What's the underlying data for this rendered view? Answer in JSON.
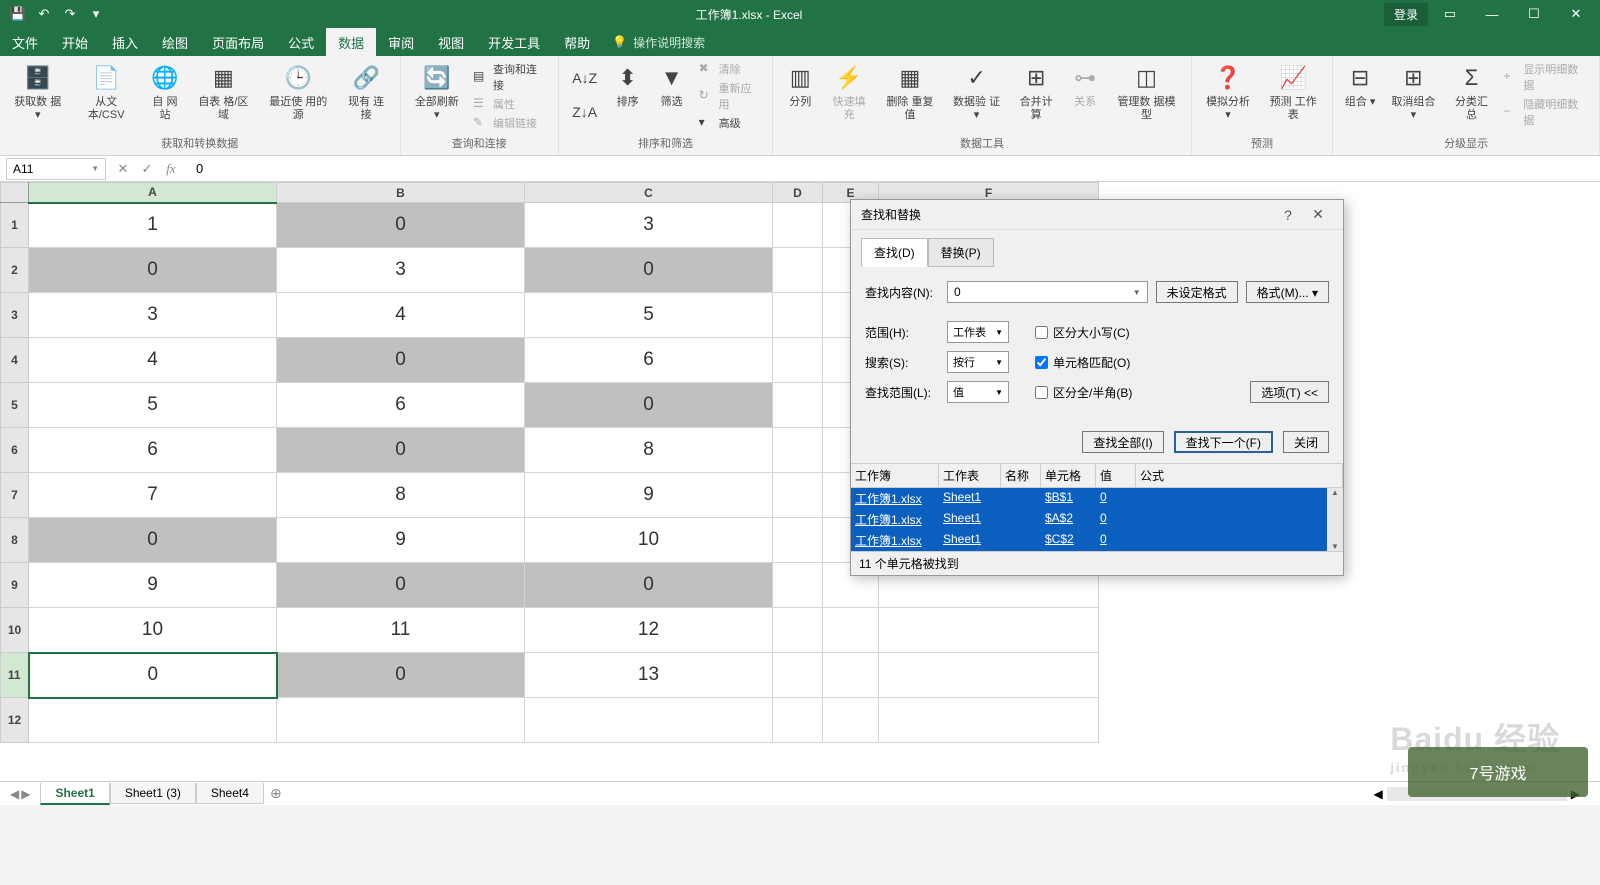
{
  "title": "工作簿1.xlsx - Excel",
  "qat": {
    "save": "💾",
    "undo": "↶",
    "redo": "↷",
    "custom": "▾"
  },
  "login": "登录",
  "menu": [
    "文件",
    "开始",
    "插入",
    "绘图",
    "页面布局",
    "公式",
    "数据",
    "审阅",
    "视图",
    "开发工具",
    "帮助"
  ],
  "menu_active": 6,
  "tell_me": "操作说明搜索",
  "ribbon": {
    "g1": {
      "label": "获取和转换数据",
      "btns": [
        "获取数\n据 ▾",
        "从文\n本/CSV",
        "自\n网站",
        "自表\n格/区域",
        "最近使\n用的源",
        "现有\n连接"
      ]
    },
    "g2": {
      "label": "查询和连接",
      "main": "全部刷新\n▾",
      "side": [
        "查询和连接",
        "属性",
        "编辑链接"
      ]
    },
    "g3": {
      "label": "排序和筛选",
      "btns": [
        "排序",
        "筛选"
      ],
      "side": [
        "清除",
        "重新应用",
        "高级"
      ]
    },
    "g4": {
      "label": "数据工具",
      "btns": [
        "分列",
        "快速填充",
        "删除\n重复值",
        "数据验\n证 ▾",
        "合并计算",
        "关系",
        "管理数\n据模型"
      ]
    },
    "g5": {
      "label": "预测",
      "btns": [
        "模拟分析\n▾",
        "预测\n工作表"
      ]
    },
    "g6": {
      "label": "分级显示",
      "btns": [
        "组合\n▾",
        "取消组合\n▾",
        "分类汇总"
      ],
      "side": [
        "显示明细数据",
        "隐藏明细数据"
      ]
    }
  },
  "namebox": "A11",
  "formula": "0",
  "columns": [
    "A",
    "B",
    "C",
    "D",
    "E",
    "F"
  ],
  "data_cells": [
    [
      {
        "v": "1",
        "s": 0
      },
      {
        "v": "0",
        "s": 1
      },
      {
        "v": "3",
        "s": 0
      }
    ],
    [
      {
        "v": "0",
        "s": 1
      },
      {
        "v": "3",
        "s": 0
      },
      {
        "v": "0",
        "s": 1
      }
    ],
    [
      {
        "v": "3",
        "s": 0
      },
      {
        "v": "4",
        "s": 0
      },
      {
        "v": "5",
        "s": 0
      }
    ],
    [
      {
        "v": "4",
        "s": 0
      },
      {
        "v": "0",
        "s": 1
      },
      {
        "v": "6",
        "s": 0
      }
    ],
    [
      {
        "v": "5",
        "s": 0
      },
      {
        "v": "6",
        "s": 0
      },
      {
        "v": "0",
        "s": 1
      }
    ],
    [
      {
        "v": "6",
        "s": 0
      },
      {
        "v": "0",
        "s": 1
      },
      {
        "v": "8",
        "s": 0
      }
    ],
    [
      {
        "v": "7",
        "s": 0
      },
      {
        "v": "8",
        "s": 0
      },
      {
        "v": "9",
        "s": 0
      }
    ],
    [
      {
        "v": "0",
        "s": 1
      },
      {
        "v": "9",
        "s": 0
      },
      {
        "v": "10",
        "s": 0
      }
    ],
    [
      {
        "v": "9",
        "s": 0
      },
      {
        "v": "0",
        "s": 1
      },
      {
        "v": "0",
        "s": 1
      }
    ],
    [
      {
        "v": "10",
        "s": 0
      },
      {
        "v": "11",
        "s": 0
      },
      {
        "v": "12",
        "s": 0
      }
    ],
    [
      {
        "v": "0",
        "s": 0
      },
      {
        "v": "0",
        "s": 1
      },
      {
        "v": "13",
        "s": 0
      }
    ]
  ],
  "active_cell": {
    "row": 11,
    "col": 0
  },
  "dialog": {
    "title": "查找和替换",
    "tabs": [
      "查找(D)",
      "替换(P)"
    ],
    "find_label": "查找内容(N):",
    "find_value": "0",
    "no_format": "未设定格式",
    "format_btn": "格式(M)... ▾",
    "range_label": "范围(H):",
    "range_val": "工作表",
    "search_label": "搜索(S):",
    "search_val": "按行",
    "lookin_label": "查找范围(L):",
    "lookin_val": "值",
    "chk_case": "区分大小写(C)",
    "chk_whole": "单元格匹配(O)",
    "chk_width": "区分全/半角(B)",
    "options_btn": "选项(T) <<",
    "find_all": "查找全部(I)",
    "find_next": "查找下一个(F)",
    "close": "关闭",
    "cols": [
      "工作簿",
      "工作表",
      "名称",
      "单元格",
      "值",
      "公式"
    ],
    "results": [
      {
        "wb": "工作簿1.xlsx",
        "ws": "Sheet1",
        "nm": "",
        "cell": "$B$1",
        "val": "0",
        "fm": ""
      },
      {
        "wb": "工作簿1.xlsx",
        "ws": "Sheet1",
        "nm": "",
        "cell": "$A$2",
        "val": "0",
        "fm": ""
      },
      {
        "wb": "工作簿1.xlsx",
        "ws": "Sheet1",
        "nm": "",
        "cell": "$C$2",
        "val": "0",
        "fm": ""
      }
    ],
    "status": "11 个单元格被找到"
  },
  "sheets": [
    "Sheet1",
    "Sheet1 (3)",
    "Sheet4"
  ],
  "watermark": {
    "main": "Baidu 经验",
    "sub": "jingyan.baidu.com",
    "corner": "7号游戏"
  }
}
